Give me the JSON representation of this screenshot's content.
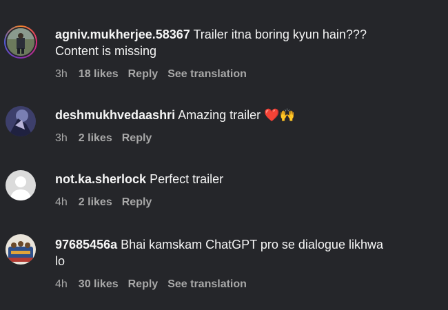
{
  "comments": [
    {
      "username": "agniv.mukherjee.58367",
      "text_line1": "Trailer itna boring kyun hain???",
      "text_line2": "Content is missing",
      "time": "3h",
      "likes": "18 likes",
      "reply": "Reply",
      "translation": "See translation"
    },
    {
      "username": "deshmukhvedaashri",
      "text_line1": "Amazing trailer",
      "emoji": "❤️🙌",
      "time": "3h",
      "likes": "2 likes",
      "reply": "Reply"
    },
    {
      "username": "not.ka.sherlock",
      "text_line1": "Perfect trailer",
      "time": "4h",
      "likes": "2 likes",
      "reply": "Reply"
    },
    {
      "username": "97685456a",
      "text_line1": "Bhai kamskam ChatGPT pro se dialogue likhwa",
      "text_line2": "lo",
      "time": "4h",
      "likes": "30 likes",
      "reply": "Reply",
      "translation": "See translation"
    }
  ]
}
